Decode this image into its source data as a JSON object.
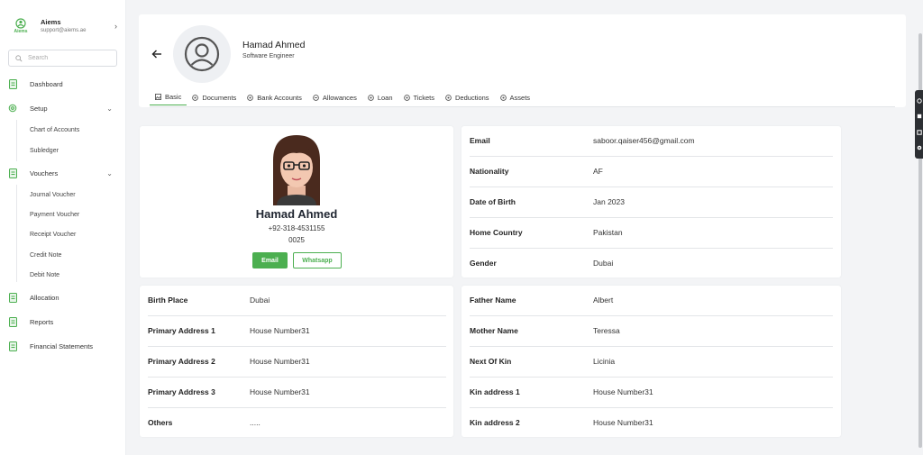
{
  "brand": {
    "name": "Aiems",
    "email": "support@aiems.ae",
    "logo_text": "Aiems"
  },
  "search": {
    "placeholder": "Search"
  },
  "nav": {
    "dashboard": "Dashboard",
    "setup": "Setup",
    "setup_items": [
      "Chart of Accounts",
      "Subledger"
    ],
    "vouchers": "Vouchers",
    "voucher_items": [
      "Journal Voucher",
      "Payment Voucher",
      "Receipt Voucher",
      "Credit Note",
      "Debit Note"
    ],
    "allocation": "Allocation",
    "reports": "Reports",
    "financial_statements": "Financial Statements"
  },
  "header": {
    "name": "Hamad Ahmed",
    "role": "Software Engineer"
  },
  "tabs": [
    "Basic",
    "Documents",
    "Bank Accounts",
    "Allowances",
    "Loan",
    "Tickets",
    "Deductions",
    "Assets"
  ],
  "profile": {
    "name": "Hamad Ahmed",
    "phone": "+92-318-4531155",
    "code": "0025",
    "email_button": "Email",
    "whatsapp_button": "Whatsapp"
  },
  "contact_info": [
    {
      "label": "Email",
      "value": "saboor.qaiser456@gmail.com"
    },
    {
      "label": "Nationality",
      "value": "AF"
    },
    {
      "label": "Date of Birth",
      "value": "Jan 2023"
    },
    {
      "label": "Home Country",
      "value": "Pakistan"
    },
    {
      "label": "Gender",
      "value": "Dubai"
    }
  ],
  "address_info": [
    {
      "label": "Birth Place",
      "value": "Dubai"
    },
    {
      "label": "Primary Address 1",
      "value": "House Number31"
    },
    {
      "label": "Primary Address 2",
      "value": "House Number31"
    },
    {
      "label": "Primary Address 3",
      "value": "House Number31"
    },
    {
      "label": "Others",
      "value": "....."
    }
  ],
  "family_info": [
    {
      "label": "Father Name",
      "value": "Albert"
    },
    {
      "label": "Mother Name",
      "value": "Teressa"
    },
    {
      "label": "Next Of Kin",
      "value": "Licinia"
    },
    {
      "label": "Kin address 1",
      "value": "House Number31"
    },
    {
      "label": "Kin address 2",
      "value": "House Number31"
    }
  ],
  "colors": {
    "accent": "#4caf50",
    "background": "#f3f4f6",
    "card": "#ffffff"
  },
  "icons": {
    "back": "arrow-left-icon",
    "avatar": "user-circle-icon",
    "search": "search-icon",
    "nav": "document-icon",
    "setup": "gear-icon"
  }
}
